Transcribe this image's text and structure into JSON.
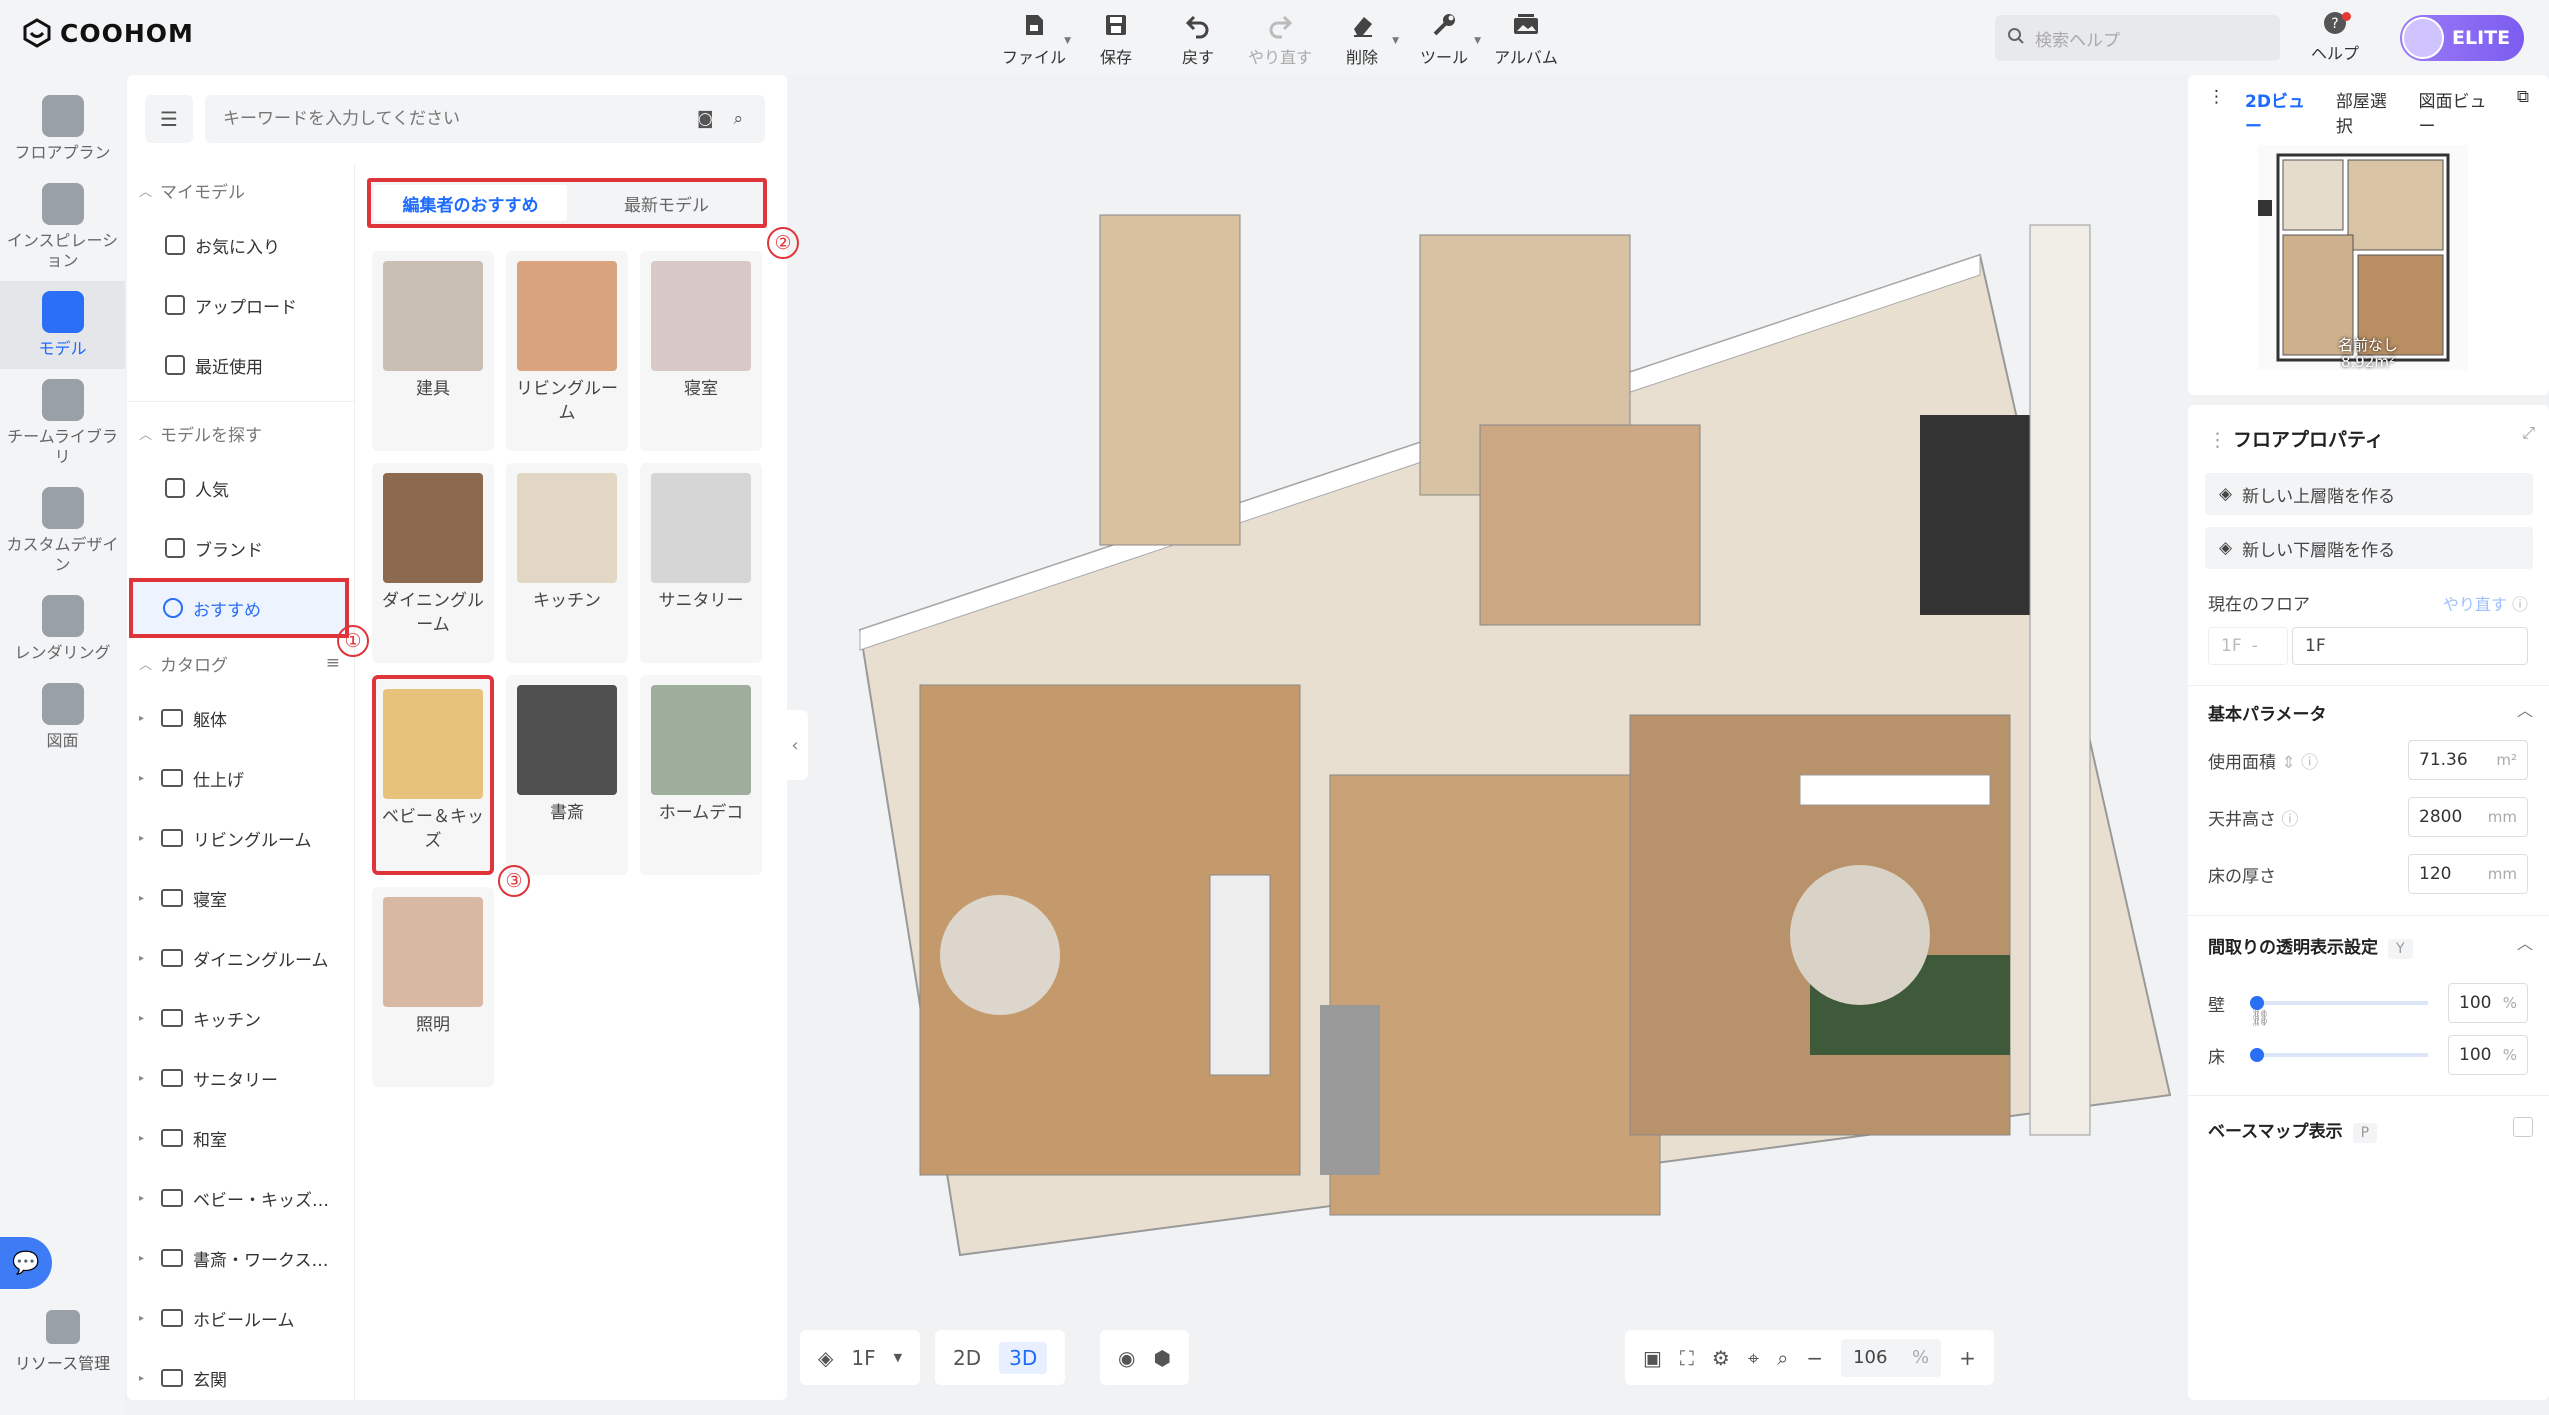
{
  "app": {
    "logo": "COOHOM"
  },
  "toolbar": [
    {
      "label": "ファイル",
      "icon": "file-icon",
      "has_caret": true
    },
    {
      "label": "保存",
      "icon": "save-icon",
      "has_caret": false
    },
    {
      "label": "戻す",
      "icon": "undo-icon",
      "has_caret": false
    },
    {
      "label": "やり直す",
      "icon": "redo-icon",
      "has_caret": false,
      "disabled": true
    },
    {
      "label": "削除",
      "icon": "eraser-icon",
      "has_caret": true
    },
    {
      "label": "ツール",
      "icon": "wrench-icon",
      "has_caret": true
    },
    {
      "label": "アルバム",
      "icon": "album-icon",
      "has_caret": false
    }
  ],
  "help_search": {
    "placeholder": "検索ヘルプ"
  },
  "help_label": "ヘルプ",
  "elite_badge": "ELITE",
  "rail": [
    {
      "label": "フロアプラン",
      "active": false
    },
    {
      "label": "インスピレーション",
      "active": false
    },
    {
      "label": "モデル",
      "active": true
    },
    {
      "label": "チームライブラリ",
      "active": false
    },
    {
      "label": "カスタムデザイン",
      "active": false
    },
    {
      "label": "レンダリング",
      "active": false
    },
    {
      "label": "図面",
      "active": false
    }
  ],
  "rail_bottom": "リソース管理",
  "search": {
    "placeholder": "キーワードを入力してください"
  },
  "tree": {
    "my_models": "マイモデル",
    "my_items": [
      "お気に入り",
      "アップロード",
      "最近使用"
    ],
    "find_models": "モデルを探す",
    "find_items": [
      "人気",
      "ブランド",
      "おすすめ"
    ],
    "catalog": "カタログ",
    "catalog_items": [
      "躯体",
      "仕上げ",
      "リビングルーム",
      "寝室",
      "ダイニングルーム",
      "キッチン",
      "サニタリー",
      "和室",
      "ベビー・キッズ…",
      "書斎・ワークス…",
      "ホビールーム",
      "玄関"
    ]
  },
  "tabs": [
    "編集者のおすすめ",
    "最新モデル"
  ],
  "markers": [
    "①",
    "②",
    "③"
  ],
  "cards": [
    {
      "label": "建具",
      "color": "#c9bfb3"
    },
    {
      "label": "リビングルーム",
      "color": "#d8a37e"
    },
    {
      "label": "寝室",
      "color": "#d8c9c8"
    },
    {
      "label": "ダイニングルーム",
      "color": "#8c6a50"
    },
    {
      "label": "キッチン",
      "color": "#e2d7c4"
    },
    {
      "label": "サニタリー",
      "color": "#d6d6d6"
    },
    {
      "label": "ベビー＆キッズ",
      "color": "#e6c27a"
    },
    {
      "label": "書斎",
      "color": "#505050"
    },
    {
      "label": "ホームデコ",
      "color": "#9fae9c"
    },
    {
      "label": "照明",
      "color": "#d9b8a3"
    }
  ],
  "bottom": {
    "floor": "1F",
    "mode_2d": "2D",
    "mode_3d": "3D",
    "zoom": "106",
    "zoom_unit": "%"
  },
  "right": {
    "tabs": [
      "2Dビュー",
      "部屋選択",
      "図面ビュー"
    ],
    "minimap_label": "名前なし",
    "minimap_area": "8.92m²",
    "title": "フロアプロパティ",
    "btn_upper": "新しい上層階を作る",
    "btn_lower": "新しい下層階を作る",
    "current_floor_label": "現在のフロア",
    "redo_label": "やり直す",
    "floor_prefix": "1F",
    "floor_sep": "-",
    "floor_name": "1F",
    "basic_params": "基本パラメータ",
    "area_label": "使用面積",
    "area_value": "71.36",
    "area_unit": "m²",
    "ceiling_label": "天井高さ",
    "ceiling_value": "2800",
    "ceiling_unit": "mm",
    "floor_thick_label": "床の厚さ",
    "floor_thick_value": "120",
    "floor_thick_unit": "mm",
    "transparency_label": "間取りの透明表示設定",
    "transparency_key": "Y",
    "wall_label": "壁",
    "wall_value": "100",
    "wall_level": 1.0,
    "floor_label": "床",
    "floor_value": "100",
    "floor_level": 1.0,
    "pct": "%",
    "basemap_label": "ベースマップ表示",
    "basemap_key": "P"
  }
}
